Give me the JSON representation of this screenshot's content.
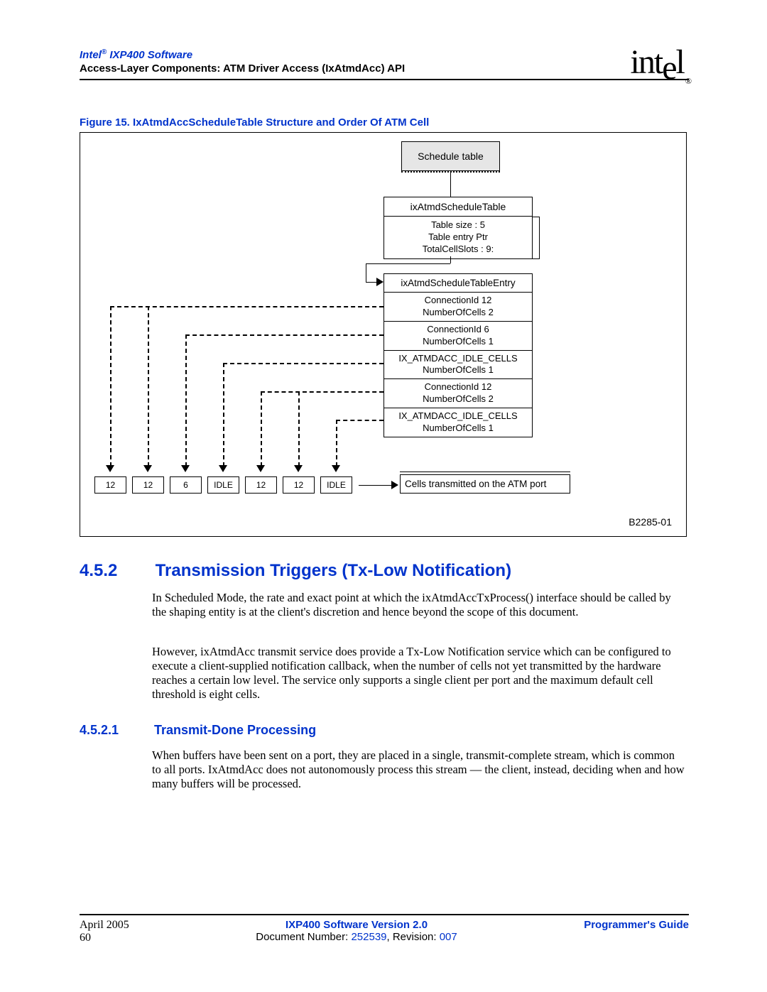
{
  "header": {
    "product": "Intel",
    "product_suffix": " IXP400 Software",
    "subtitle": "Access-Layer Components: ATM Driver Access (IxAtmdAcc) API",
    "logo_text": "intel",
    "logo_reg": "®"
  },
  "figure": {
    "caption": "Figure 15. IxAtmdAccScheduleTable Structure and Order Of ATM Cell",
    "schedule_label": "Schedule table",
    "table_name": "ixAtmdScheduleTable",
    "table_size": "Table size : 5",
    "table_ptr": "Table entry Ptr",
    "total_slots": "TotalCellSlots : 9:",
    "entry_name": "ixAtmdScheduleTableEntry",
    "entries": [
      {
        "conn": "ConnectionId 12",
        "cells": "NumberOfCells 2"
      },
      {
        "conn": "ConnectionId 6",
        "cells": "NumberOfCells 1"
      },
      {
        "conn": "IX_ATMDACC_IDLE_CELLS",
        "cells": "NumberOfCells 1"
      },
      {
        "conn": "ConnectionId 12",
        "cells": "NumberOfCells 2"
      },
      {
        "conn": "IX_ATMDACC_IDLE_CELLS",
        "cells": "NumberOfCells 1"
      }
    ],
    "cells_tx_label": "Cells transmitted on the ATM port",
    "strip": [
      "12",
      "12",
      "6",
      "IDLE",
      "12",
      "12",
      "IDLE"
    ],
    "ref": "B2285-01"
  },
  "sections": {
    "s452_num": "4.5.2",
    "s452_title": "Transmission Triggers (Tx-Low Notification)",
    "s452_p1": "In Scheduled Mode, the rate and exact point at which the ixAtmdAccTxProcess() interface should be called by the shaping entity is at the client's discretion and hence beyond the scope of this document.",
    "s452_p2": "However, ixAtmdAcc transmit service does provide a Tx-Low Notification service which can be configured to execute a client-supplied notification callback, when the number of cells not yet transmitted by the hardware reaches a certain low level. The service only supports a single client per port and the maximum default cell threshold is eight cells.",
    "s4521_num": "4.5.2.1",
    "s4521_title": "Transmit-Done Processing",
    "s4521_p1": "When buffers have been sent on a port, they are placed in a single, transmit-complete stream, which is common to all ports. IxAtmdAcc does not autonomously process this stream — the client, instead, deciding when and how many buffers will be processed."
  },
  "footer": {
    "date": "April 2005",
    "page": "60",
    "version": "IXP400 Software Version 2.0",
    "docnum_prefix": "Document Number: ",
    "docnum": "252539",
    "rev_prefix": ", Revision: ",
    "rev": "007",
    "guide": "Programmer's Guide"
  }
}
